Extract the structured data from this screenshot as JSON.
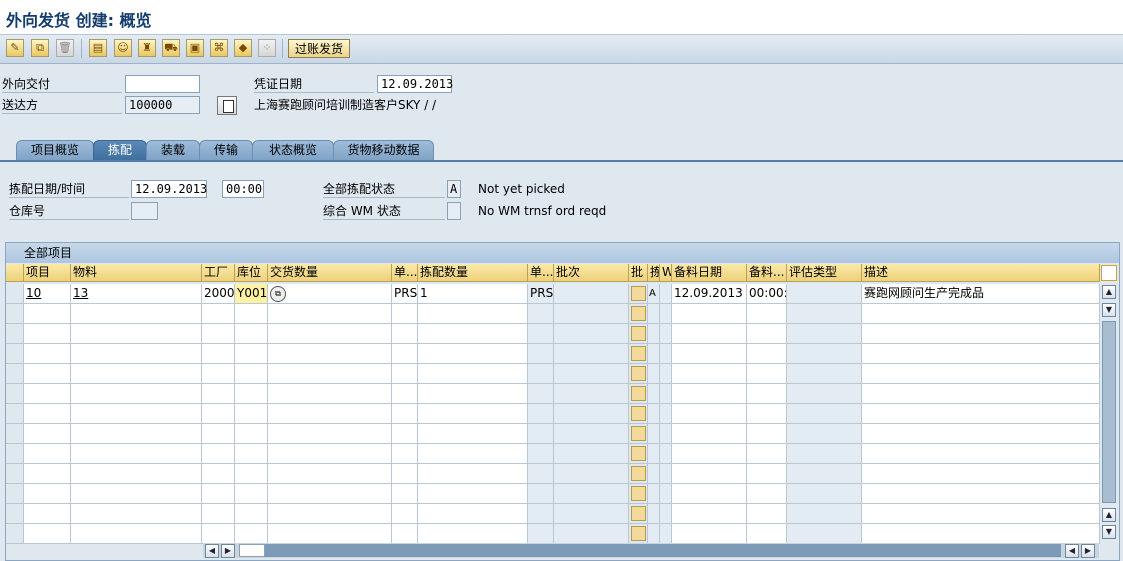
{
  "window": {
    "title": "外向发货 创建: 概览"
  },
  "toolbar": {
    "icons": [
      "edit-icon",
      "display-change-icon",
      "delete-icon",
      "header-icon",
      "partner-icon",
      "hat-icon",
      "transport-icon",
      "packing-icon",
      "picking-icon",
      "stock-icon",
      "batch-icon"
    ],
    "post_button": "过账发货"
  },
  "header_form": {
    "delivery_label": "外向交付",
    "delivery_value": "",
    "ship_to_label": "送达方",
    "ship_to_value": "100000",
    "doc_date_label": "凭证日期",
    "doc_date_value": "12.09.2013",
    "ship_to_name": "上海赛跑顾问培训制造客户SKY / /"
  },
  "tabs": [
    {
      "label": "项目概览",
      "active": false
    },
    {
      "label": "拣配",
      "active": true
    },
    {
      "label": "装载",
      "active": false
    },
    {
      "label": "传输",
      "active": false
    },
    {
      "label": "状态概览",
      "active": false
    },
    {
      "label": "货物移动数据",
      "active": false
    }
  ],
  "picking": {
    "date_time_label": "拣配日期/时间",
    "date_value": "12.09.2013",
    "time_value": "00:00",
    "warehouse_label": "仓库号",
    "warehouse_value": "",
    "overall_status_label": "全部拣配状态",
    "overall_status_code": "A",
    "overall_status_text": "Not yet picked",
    "wm_status_label": "综合 WM 状态",
    "wm_status_code": "",
    "wm_status_text": "No WM trnsf ord reqd"
  },
  "table": {
    "title": "全部项目",
    "columns": [
      "项目",
      "物料",
      "工厂",
      "库位",
      "交货数量",
      "单...",
      "拣配数量",
      "单...",
      "批次",
      "批",
      "拣",
      "W",
      "备料日期",
      "备料...",
      "评估类型",
      "描述"
    ],
    "rows": [
      {
        "item": "10",
        "material": "13",
        "plant": "2000",
        "sloc": "Y001",
        "dlv_qty": "",
        "unit": "PRS",
        "pick_qty": "1",
        "unit2": "PRS",
        "batch": "",
        "a": "A",
        "w": "",
        "date": "12.09.2013",
        "time": "00:00:",
        "val_type": "",
        "desc": "赛跑网顾问生产完成品"
      }
    ]
  },
  "colors": {
    "accent": "#3f6f9e",
    "header_yellow": "#edd27a",
    "background": "#dfe7ef"
  }
}
